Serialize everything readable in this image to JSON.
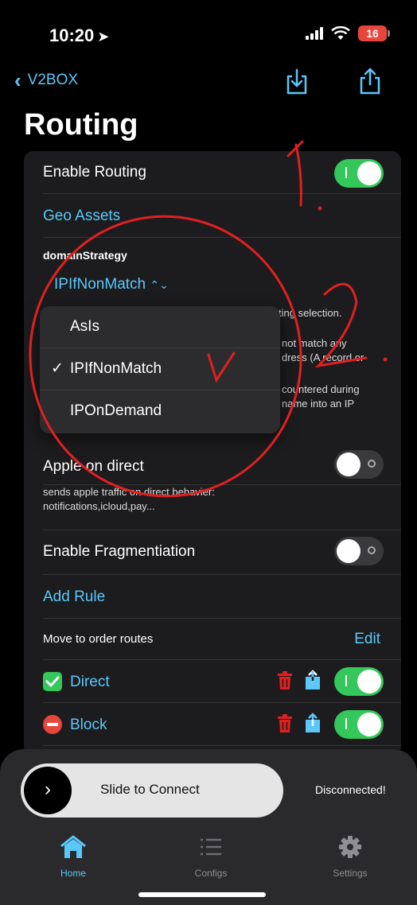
{
  "status_bar": {
    "time": "10:20",
    "battery": "16"
  },
  "nav": {
    "back_label": "V2BOX"
  },
  "page": {
    "title": "Routing"
  },
  "settings": {
    "enable_routing": {
      "label": "Enable Routing",
      "on": true
    },
    "geo_assets": "Geo Assets",
    "domain_strategy": {
      "label": "domainStrategy",
      "value": "IPIfNonMatch",
      "chevron": "⌃⌄",
      "desc_fragments": [
        "ting selection.",
        "not match any",
        "dress (A record or",
        "countered during",
        "name into an IP"
      ]
    },
    "apple_direct": {
      "label": "Apple on direct",
      "desc_line1": "sends apple traffic on direct behavier:",
      "desc_line2": "notifications,icloud,pay...",
      "on": false
    },
    "fragmentation": {
      "label": "Enable Fragmentiation",
      "on": false
    },
    "add_rule": "Add Rule",
    "order": {
      "label": "Move to order routes",
      "edit": "Edit"
    },
    "rules": [
      {
        "name": "Direct",
        "icon": "green-check-icon",
        "on": true
      },
      {
        "name": "Block",
        "icon": "no-entry-icon",
        "on": true
      }
    ]
  },
  "menu": {
    "options": [
      "AsIs",
      "IPIfNonMatch",
      "IPOnDemand"
    ],
    "selected": "IPIfNonMatch",
    "check": "✓"
  },
  "bottom": {
    "slider_text": "Slide to Connect",
    "slider_arrow": "›",
    "status": "Disconnected!",
    "tabs": [
      {
        "label": "Home",
        "icon": "house-icon",
        "active": true
      },
      {
        "label": "Configs",
        "icon": "list-icon",
        "active": false
      },
      {
        "label": "Settings",
        "icon": "gear-icon",
        "active": false
      }
    ]
  },
  "colors": {
    "accent": "#5ac8fa",
    "toggle_on": "#34c759",
    "annotation": "#e02020"
  }
}
